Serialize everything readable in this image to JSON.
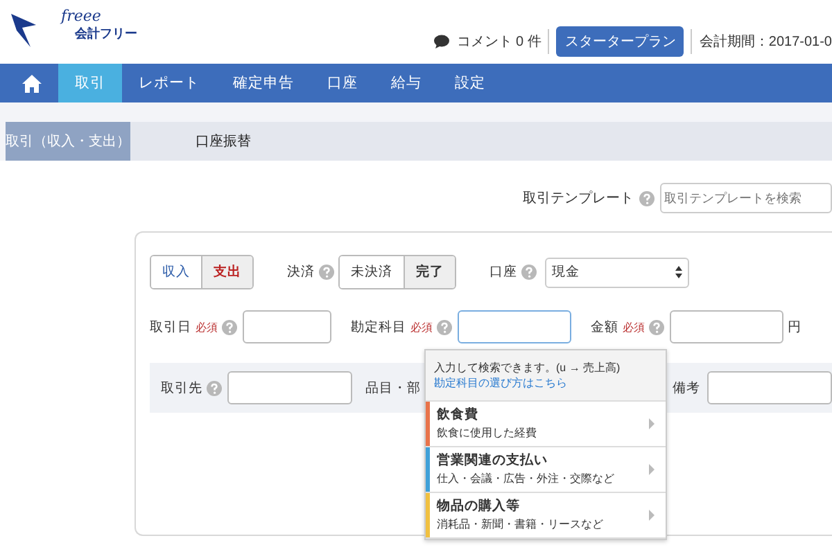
{
  "header": {
    "logo_script": "freee",
    "logo_text": "会計フリー",
    "comments": "コメント 0 件",
    "plan_button": "スタータープラン",
    "period": "会計期間：2017-01-0"
  },
  "nav": [
    {
      "kind": "home",
      "selected": false
    },
    {
      "kind": "text",
      "label": "取引",
      "selected": true
    },
    {
      "kind": "text",
      "label": "レポート",
      "selected": false
    },
    {
      "kind": "text",
      "label": "確定申告",
      "selected": false
    },
    {
      "kind": "text",
      "label": "口座",
      "selected": false
    },
    {
      "kind": "text",
      "label": "給与",
      "selected": false
    },
    {
      "kind": "text",
      "label": "設定",
      "selected": false
    }
  ],
  "tabs": [
    {
      "label": "取引（収入・支出）",
      "selected": true
    },
    {
      "label": "口座振替",
      "selected": false
    }
  ],
  "template": {
    "label": "取引テンプレート",
    "placeholder": "取引テンプレートを検索"
  },
  "form": {
    "type_toggle": [
      {
        "label": "収入",
        "kind": "income",
        "selected": false
      },
      {
        "label": "支出",
        "kind": "expense",
        "selected": true
      }
    ],
    "settlement": {
      "label": "決済",
      "options": [
        {
          "label": "未決済",
          "selected": false
        },
        {
          "label": "完了",
          "selected": true
        }
      ]
    },
    "account": {
      "label": "口座",
      "value": "現金"
    },
    "fields": [
      {
        "label": "取引日",
        "badge": "必須",
        "focused": false
      },
      {
        "label": "勘定科目",
        "badge": "必須",
        "focused": true
      },
      {
        "label": "金額",
        "badge": "必須",
        "focused": false,
        "unit": "円"
      }
    ],
    "partner_label": "取引先",
    "item_label": "品目・部",
    "memo_label": "備考"
  },
  "dropdown": {
    "hint": "入力して検索できます。(u → 売上高)",
    "link": "勘定科目の選び方はこちら",
    "items": [
      {
        "title": "飲食費",
        "subtitle": "飲食に使用した経費",
        "color": "#e8734a"
      },
      {
        "title": "営業関連の支払い",
        "subtitle": "仕入・会議・広告・外注・交際など",
        "color": "#3ea0d8"
      },
      {
        "title": "物品の購入等",
        "subtitle": "消耗品・新聞・書籍・リースなど",
        "color": "#f0c040"
      }
    ]
  }
}
